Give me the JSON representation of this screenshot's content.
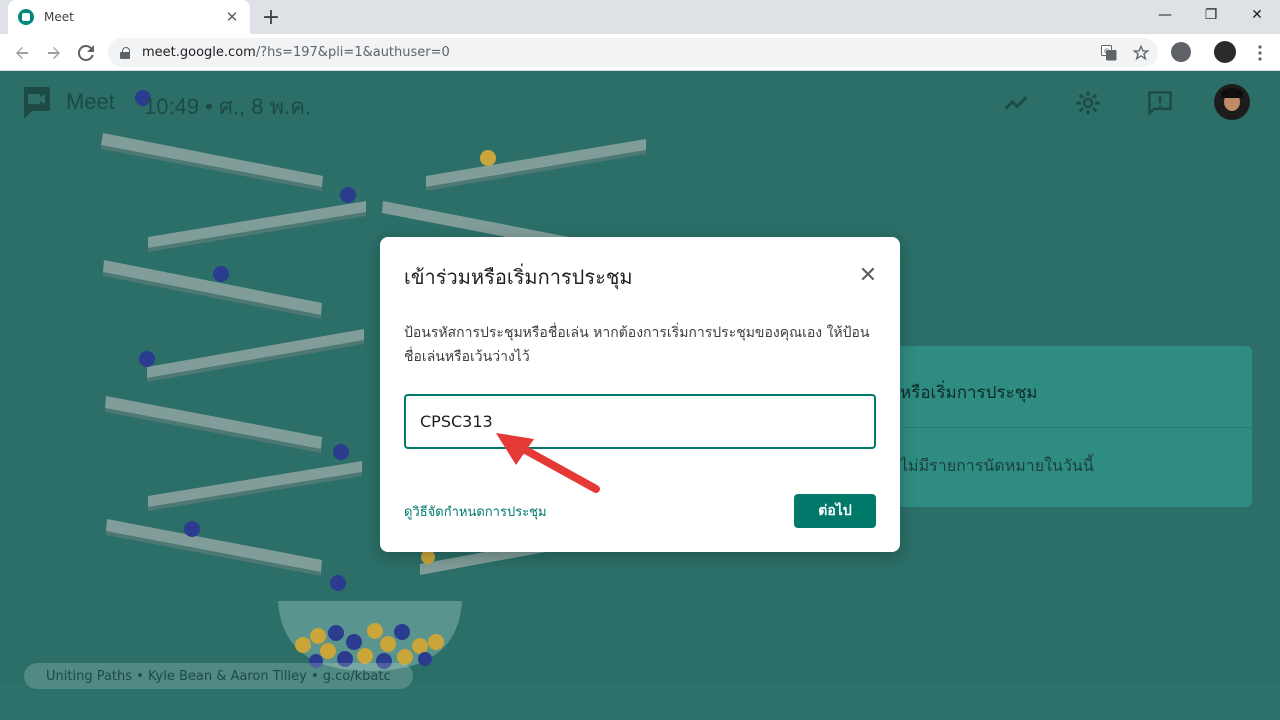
{
  "browser": {
    "tab_title": "Meet",
    "tab_close": "✕",
    "new_tab": "+",
    "url_host": "meet.google.com",
    "url_path": "/?hs=197&pli=1&authuser=0",
    "minimize": "—",
    "restore": "❐",
    "close": "✕"
  },
  "meet": {
    "wordmark": "Meet",
    "time": "10:49  •  ศ., 8 พ.ค.",
    "side_card_title": "หรือเริ่มการประชุม",
    "side_card_empty": "ไม่มีรายการนัดหมายในวันนี้",
    "credit": "Uniting Paths  •  Kyle Bean & Aaron Tilley  •  g.co/kbatc"
  },
  "dialog": {
    "title": "เข้าร่วมหรือเริ่มการประชุม",
    "close": "✕",
    "description": "ป้อนรหัสการประชุมหรือชื่อเล่น หากต้องการเริ่มการประชุมของคุณเอง ให้ป้อนชื่อเล่นหรือเว้นว่างไว้",
    "input_value": "CPSC313",
    "help_link": "ดูวิธีจัดกำหนดการประชุม",
    "next_button": "ต่อไป"
  },
  "colors": {
    "accent": "#00796b",
    "page_bg": "#2b6f68",
    "annotation": "#e53935"
  },
  "icons": {
    "back": "arrow-left-icon",
    "forward": "arrow-right-icon",
    "reload": "reload-icon",
    "translate": "translate-icon",
    "bookmark": "star-icon",
    "stats": "trending-icon",
    "settings": "gear-icon",
    "feedback": "feedback-icon"
  }
}
